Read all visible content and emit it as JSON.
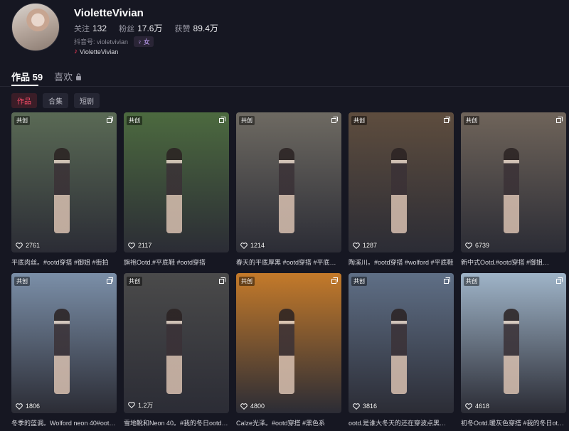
{
  "profile": {
    "username": "VioletteVivian",
    "following_label": "关注",
    "following": "132",
    "followers_label": "粉丝",
    "followers": "17.6万",
    "likes_label": "获赞",
    "likes": "89.4万",
    "douyin_id": "抖音号: violetvivian",
    "gender": "女",
    "handle": "VioletteVivian"
  },
  "tabs": [
    {
      "label": "作品 59"
    },
    {
      "label": "喜欢"
    }
  ],
  "subtabs": [
    {
      "label": "作品"
    },
    {
      "label": "合集"
    },
    {
      "label": "短剧"
    }
  ],
  "posts": [
    {
      "badge": "共创",
      "likes": "2761",
      "caption": "平底肉丝。#ootd穿搭 #御姐 #街拍",
      "bg": "#5a6a55"
    },
    {
      "badge": "共创",
      "likes": "2117",
      "caption": "旗袍Ootd.#平底鞋 #ootd穿搭",
      "bg": "#4c6a3f"
    },
    {
      "badge": "共创",
      "likes": "1214",
      "caption": "春天的平底厚黑 #ootd穿搭 #平底鞋 …",
      "bg": "#6e6a62"
    },
    {
      "badge": "共创",
      "likes": "1287",
      "caption": "陶溪川。#ootd穿搭 #wolford #平底鞋",
      "bg": "#5e4d3e"
    },
    {
      "badge": "共创",
      "likes": "6739",
      "caption": "新中式Ootd.#ootd穿搭 #御姐…",
      "bg": "#6f645a"
    },
    {
      "badge": "共创",
      "likes": "1806",
      "caption": "冬季的蓝调。Wolford neon 40#oot…",
      "bg": "#7b8fa8"
    },
    {
      "badge": "共创",
      "likes": "1.2万",
      "caption": "雪地靴和Neon 40。#我的冬日ootd…",
      "bg": "#4a4a4a"
    },
    {
      "badge": "共创",
      "likes": "4800",
      "caption": "Calze光泽。#ootd穿搭 #黑色系",
      "bg": "#c47a2a"
    },
    {
      "badge": "共创",
      "likes": "3816",
      "caption": "ootd.是谁大冬天的还在穿波点黑…",
      "bg": "#5f6f86"
    },
    {
      "badge": "共创",
      "likes": "4618",
      "caption": "初冬Ootd.暖灰色穿搭 #我的冬日ot…",
      "bg": "#9fb4c8"
    }
  ]
}
